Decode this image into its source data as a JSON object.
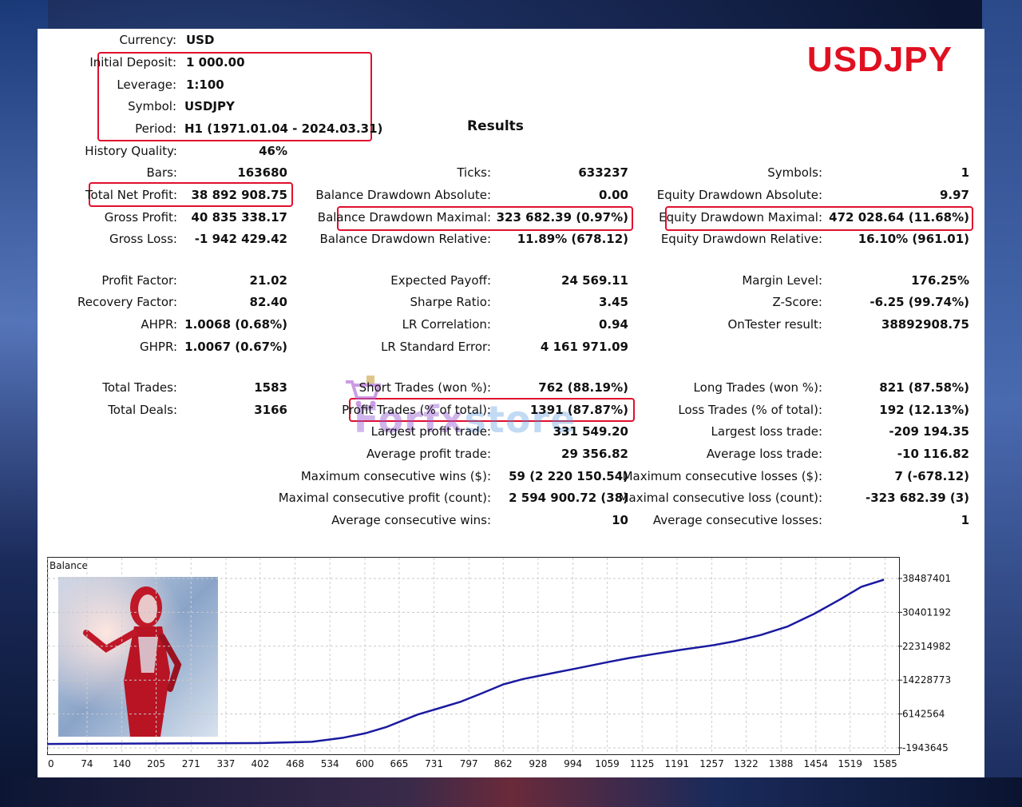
{
  "symbol_title": "USDJPY",
  "results_title": "Results",
  "info": [
    {
      "label": "Currency:",
      "value": "USD"
    },
    {
      "label": "Initial Deposit:",
      "value": "1 000.00"
    },
    {
      "label": "Leverage:",
      "value": "1:100"
    },
    {
      "label": "Symbol:",
      "value": "USDJPY"
    },
    {
      "label": "Period:",
      "value": "H1 (1971.01.04 - 2024.03.31)"
    }
  ],
  "col1": [
    {
      "label": "History Quality:",
      "value": "46%"
    },
    {
      "label": "Bars:",
      "value": "163680"
    },
    {
      "label": "Total Net Profit:",
      "value": "38 892 908.75"
    },
    {
      "label": "Gross Profit:",
      "value": "40 835 338.17"
    },
    {
      "label": "Gross Loss:",
      "value": "-1 942 429.42"
    },
    {
      "label": "Profit Factor:",
      "value": "21.02"
    },
    {
      "label": "Recovery Factor:",
      "value": "82.40"
    },
    {
      "label": "AHPR:",
      "value": "1.0068 (0.68%)"
    },
    {
      "label": "GHPR:",
      "value": "1.0067 (0.67%)"
    },
    {
      "label": "Total Trades:",
      "value": "1583"
    },
    {
      "label": "Total Deals:",
      "value": "3166"
    }
  ],
  "col2": [
    {
      "label": "Ticks:",
      "value": "633237"
    },
    {
      "label": "Balance Drawdown Absolute:",
      "value": "0.00"
    },
    {
      "label": "Balance Drawdown Maximal:",
      "value": "323 682.39 (0.97%)"
    },
    {
      "label": "Balance Drawdown Relative:",
      "value": "11.89% (678.12)"
    },
    {
      "label": "Expected Payoff:",
      "value": "24 569.11"
    },
    {
      "label": "Sharpe Ratio:",
      "value": "3.45"
    },
    {
      "label": "LR Correlation:",
      "value": "0.94"
    },
    {
      "label": "LR Standard Error:",
      "value": "4 161 971.09"
    },
    {
      "label": "Short Trades (won %):",
      "value": "762 (88.19%)"
    },
    {
      "label": "Profit Trades (% of total):",
      "value": "1391 (87.87%)"
    },
    {
      "label": "Largest profit trade:",
      "value": "331 549.20"
    },
    {
      "label": "Average profit trade:",
      "value": "29 356.82"
    },
    {
      "label": "Maximum consecutive wins ($):",
      "value": "59 (2 220 150.54)"
    },
    {
      "label": "Maximal consecutive profit (count):",
      "value": "2 594 900.72 (38)"
    },
    {
      "label": "Average consecutive wins:",
      "value": "10"
    }
  ],
  "col3": [
    {
      "label": "Symbols:",
      "value": "1"
    },
    {
      "label": "Equity Drawdown Absolute:",
      "value": "9.97"
    },
    {
      "label": "Equity Drawdown Maximal:",
      "value": "472 028.64 (11.68%)"
    },
    {
      "label": "Equity Drawdown Relative:",
      "value": "16.10% (961.01)"
    },
    {
      "label": "Margin Level:",
      "value": "176.25%"
    },
    {
      "label": "Z-Score:",
      "value": "-6.25 (99.74%)"
    },
    {
      "label": "OnTester result:",
      "value": "38892908.75"
    },
    {
      "label": "Long Trades (won %):",
      "value": "821 (87.58%)"
    },
    {
      "label": "Loss Trades (% of total):",
      "value": "192 (12.13%)"
    },
    {
      "label": "Largest loss trade:",
      "value": "-209 194.35"
    },
    {
      "label": "Average loss trade:",
      "value": "-10 116.82"
    },
    {
      "label": "Maximum consecutive losses ($):",
      "value": "7 (-678.12)"
    },
    {
      "label": "Maximal consecutive loss (count):",
      "value": "-323 682.39 (3)"
    },
    {
      "label": "Average consecutive losses:",
      "value": "1"
    }
  ],
  "watermark": {
    "part1": "Forfx",
    "part2": "store"
  },
  "chart_data": {
    "type": "line",
    "title": "Balance",
    "x_ticks": [
      0,
      74,
      140,
      205,
      271,
      337,
      402,
      468,
      534,
      600,
      665,
      731,
      797,
      862,
      928,
      994,
      1059,
      1125,
      1191,
      1257,
      1322,
      1388,
      1454,
      1519,
      1585
    ],
    "y_ticks": [
      38487401,
      30401192,
      22314982,
      14228773,
      6142564,
      -1943645
    ],
    "ylim": [
      -1943645,
      38487401
    ],
    "xlim": [
      0,
      1610
    ],
    "grid": true,
    "series": [
      {
        "color": "#1a1aa0",
        "x": [
          0,
          100,
          200,
          300,
          400,
          500,
          560,
          600,
          640,
          700,
          740,
          780,
          820,
          862,
          900,
          960,
          1000,
          1059,
          1100,
          1150,
          1200,
          1257,
          1300,
          1350,
          1400,
          1450,
          1500,
          1540,
          1583
        ],
        "y": [
          -1000000,
          -950000,
          -900000,
          -850000,
          -800000,
          -500000,
          500000,
          1500000,
          3000000,
          6000000,
          7500000,
          9000000,
          11000000,
          13200000,
          14500000,
          16000000,
          17000000,
          18500000,
          19500000,
          20500000,
          21500000,
          22500000,
          23500000,
          25000000,
          27000000,
          30000000,
          33500000,
          36500000,
          38200000
        ]
      }
    ]
  }
}
